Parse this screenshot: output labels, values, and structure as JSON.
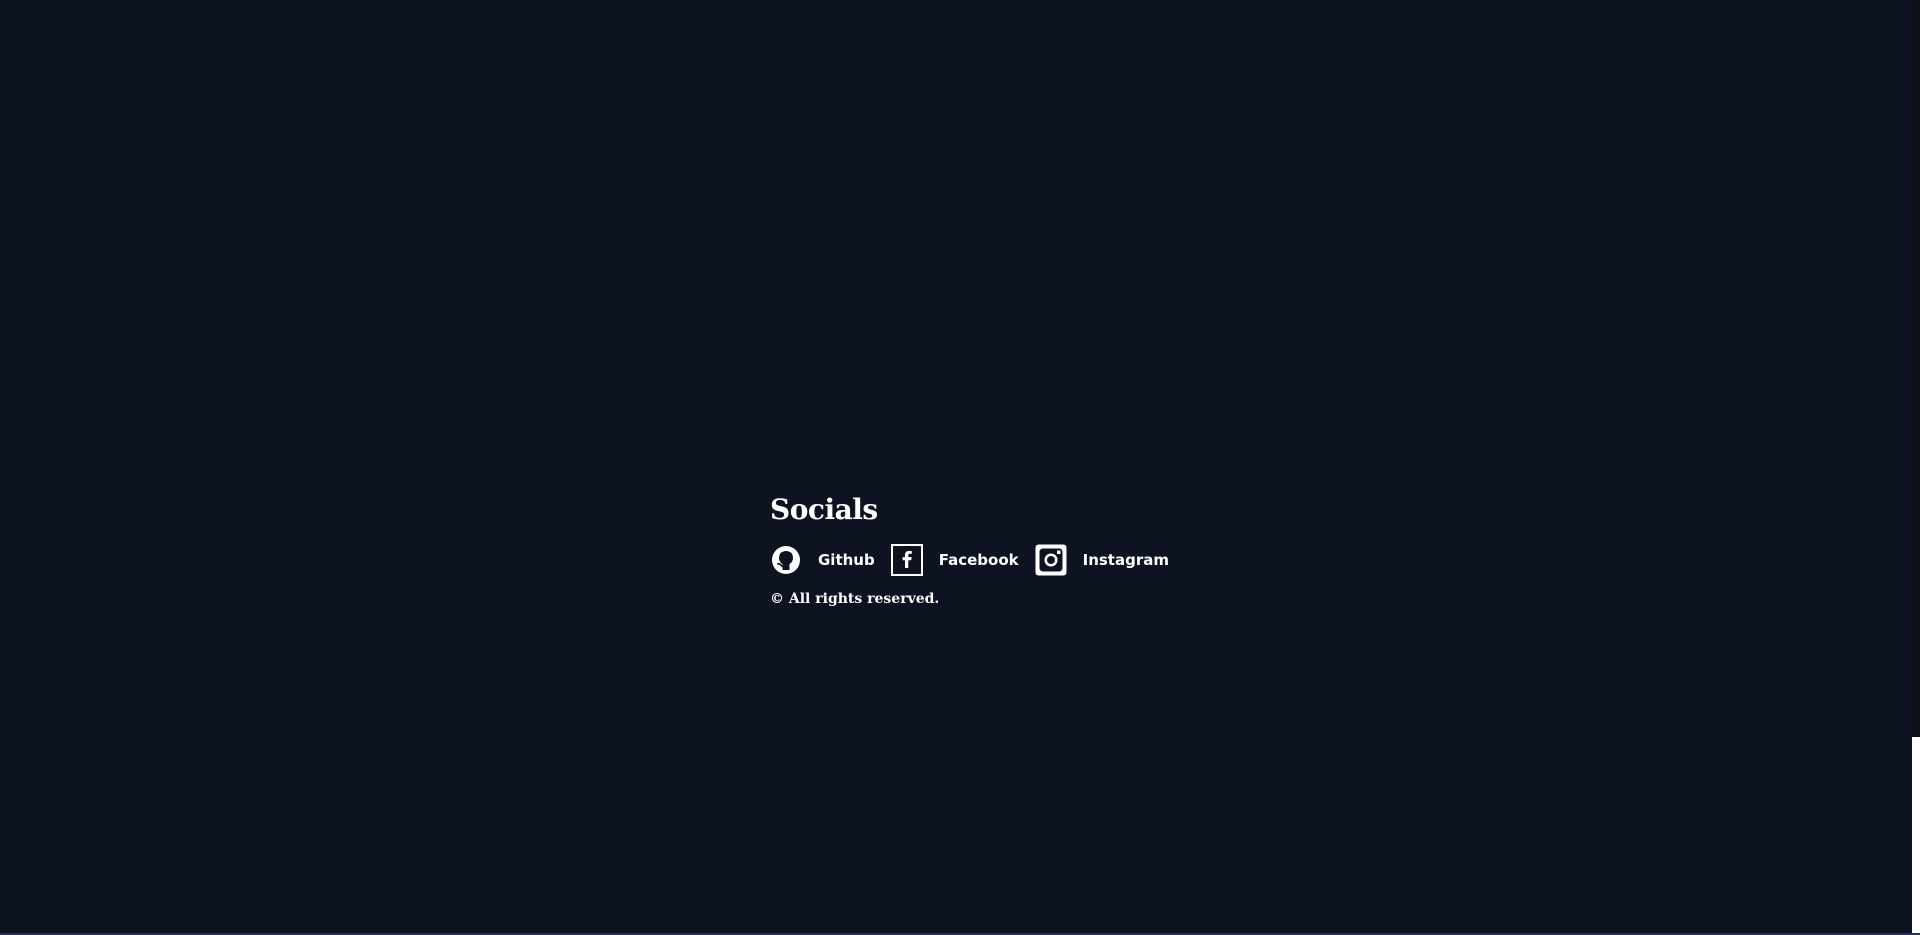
{
  "theme": {
    "background": "#0d1320",
    "text": "#ffffff",
    "scroll_thumb": "#ffffff",
    "scroll_track": "#0a0f18",
    "bottom_line": "#24305a"
  },
  "footer": {
    "title": "Socials",
    "links": [
      {
        "label": "Github",
        "icon": "github-icon"
      },
      {
        "label": "Facebook",
        "icon": "facebook-icon"
      },
      {
        "label": "Instagram",
        "icon": "instagram-icon"
      }
    ],
    "copyright": "© All rights reserved."
  }
}
